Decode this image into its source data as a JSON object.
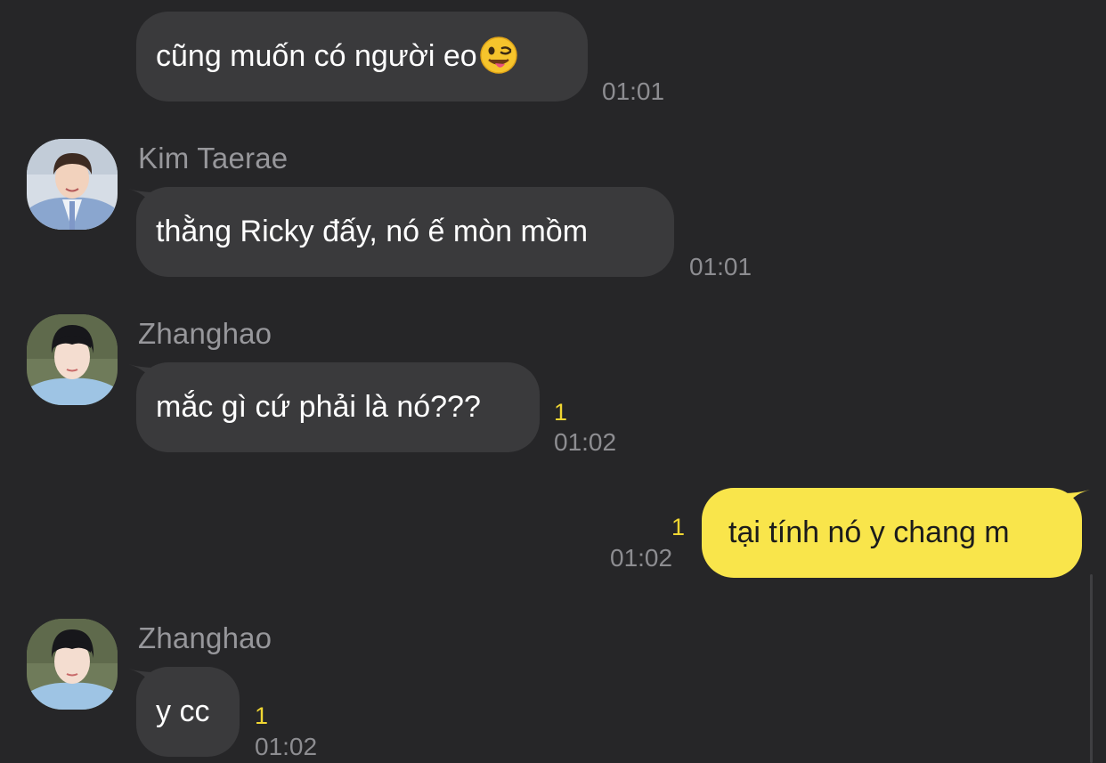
{
  "messages": [
    {
      "sender": "",
      "text": "cũng muốn có người eo",
      "emoji": "winking-tongue-emoji",
      "time": "01:01",
      "unread": ""
    },
    {
      "sender": "Kim Taerae",
      "avatar": "avatar-kim-taerae",
      "text": "thằng Ricky đấy, nó ế mòn mồm",
      "time": "01:01",
      "unread": ""
    },
    {
      "sender": "Zhanghao",
      "avatar": "avatar-zhanghao",
      "text": "mắc gì cứ phải là nó???",
      "time": "01:02",
      "unread": "1"
    },
    {
      "sender": "me",
      "text": "tại tính nó y chang m",
      "time": "01:02",
      "unread": "1"
    },
    {
      "sender": "Zhanghao",
      "avatar": "avatar-zhanghao",
      "text": "y cc",
      "time": "01:02",
      "unread": "1"
    }
  ],
  "colors": {
    "background": "#262628",
    "incoming_bubble": "#3a3a3c",
    "outgoing_bubble": "#f9e54b",
    "unread_count": "#f0d632",
    "secondary_text": "#8d8d91"
  }
}
